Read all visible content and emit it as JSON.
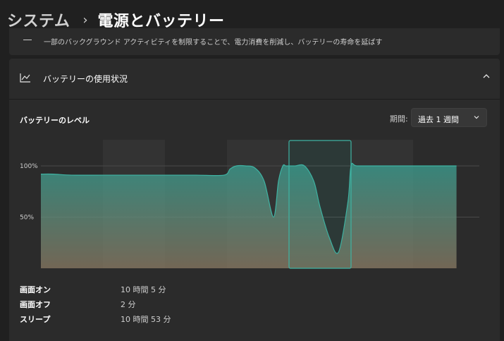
{
  "breadcrumb": {
    "parent": "システム",
    "separator": "›",
    "current": "電源とバッテリー"
  },
  "battery_saver_card": {
    "description": "一部のバックグラウンド アクティビティを制限することで、電力消費を削減し、バッテリーの寿命を延ばす"
  },
  "usage_section": {
    "title": "バッテリーの使用状況",
    "expanded": true
  },
  "battery_level": {
    "title": "バッテリーのレベル",
    "period_label": "期間:",
    "period_value": "過去 1 週間"
  },
  "chart_data": {
    "type": "area",
    "title": "",
    "xlabel": "",
    "ylabel": "",
    "ylim": [
      0,
      100
    ],
    "yticks": [
      "100%",
      "50%"
    ],
    "x": [
      0,
      0.2,
      0.5,
      1.0,
      1.5,
      2.0,
      2.5,
      2.95,
      3.05,
      3.15,
      3.3,
      3.45,
      3.6,
      3.75,
      3.83,
      3.9,
      3.95,
      4.0,
      4.1,
      4.25,
      4.4,
      4.5,
      4.65,
      4.8,
      4.95,
      5.0,
      5.1,
      5.5,
      6.0,
      6.5,
      6.7
    ],
    "series": [
      {
        "values": [
          92,
          92,
          91,
          91,
          91,
          91,
          91,
          91,
          97,
          100,
          100,
          98,
          85,
          50,
          85,
          100,
          100,
          100,
          100,
          100,
          85,
          60,
          30,
          16,
          65,
          100,
          100,
          100,
          100,
          100,
          100
        ]
      }
    ],
    "day_bands": 7,
    "highlighted_band": 4,
    "colors": {
      "fill_top": "#3aa395",
      "line": "#3fb3a3",
      "fill_bottom": "#8a7a63"
    }
  },
  "usage_stats": [
    {
      "label": "画面オン",
      "value": "10 時間 5 分"
    },
    {
      "label": "画面オフ",
      "value": "2 分"
    },
    {
      "label": "スリープ",
      "value": "10 時間 53 分"
    }
  ]
}
